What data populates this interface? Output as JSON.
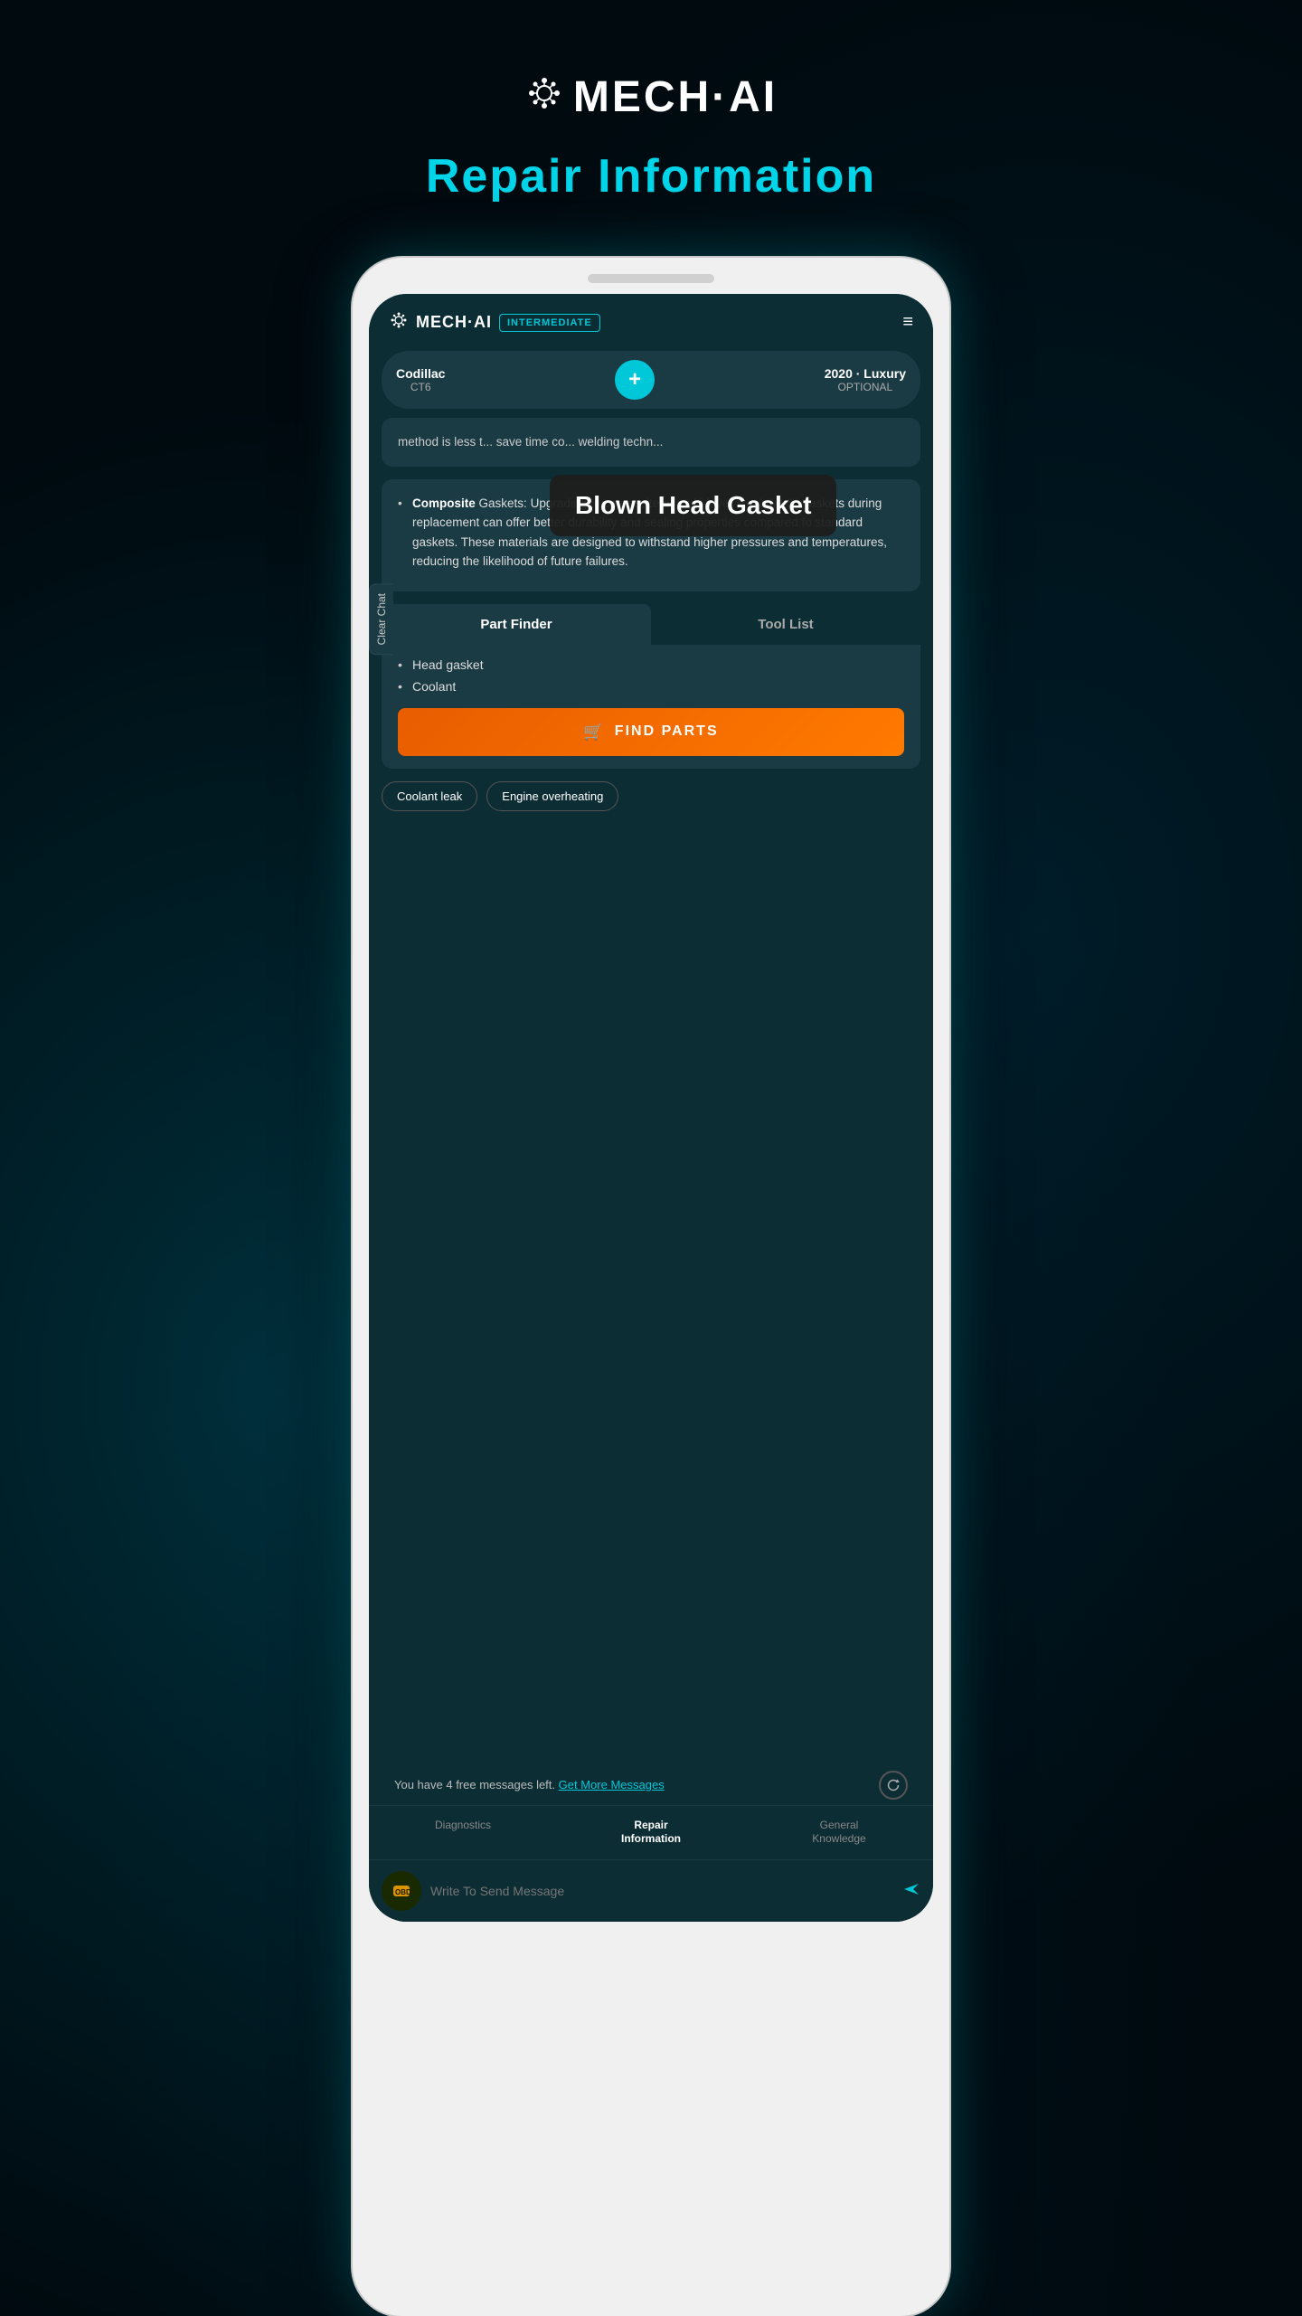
{
  "app": {
    "logo_icon": "⚙",
    "logo_text": "MECH·AI",
    "page_title": "Repair Information"
  },
  "phone": {
    "topbar": {
      "logo_icon": "⚙",
      "logo_text": "MECH·AI",
      "badge": "INTERMEDIATE",
      "menu_icon": "≡"
    },
    "vehicle": {
      "name": "Codillac",
      "model": "CT6",
      "add_icon": "+",
      "year": "2020 · Luxury",
      "trim": "OPTIONAL"
    },
    "clear_chat": "Clear Chat",
    "tooltip": {
      "text": "Blown Head Gasket"
    },
    "chat": {
      "message_partial": "method is less t... save time co... welding techn...",
      "bullet_label": "Composite",
      "bullet_rest": " Gaskets:",
      "bullet_desc": " Upgrading to composite or multi-layer steel (MLS) gaskets during replacement can offer better durability and sealing properties compared to standard gaskets. These materials are designed to withstand higher pressures and temperatures, reducing the likelihood of future failures."
    },
    "part_finder": {
      "tab_active": "Part Finder",
      "tab_inactive": "Tool List",
      "parts": [
        "Head gasket",
        "Coolant"
      ],
      "find_parts_btn": "FIND PARTS",
      "cart_icon": "🛒"
    },
    "chips": [
      "Coolant leak",
      "Engine overheating"
    ],
    "free_messages": {
      "text": "You have 4 free messages left.",
      "link": "Get More Messages"
    },
    "nav": {
      "items": [
        {
          "label": "Diagnostics",
          "active": false
        },
        {
          "label": "Repair\nInformation",
          "active": true
        },
        {
          "label": "General\nKnowledge",
          "active": false
        }
      ]
    },
    "input": {
      "placeholder": "Write To Send Message",
      "obd_icon": "🔧",
      "send_icon": "➤"
    }
  }
}
